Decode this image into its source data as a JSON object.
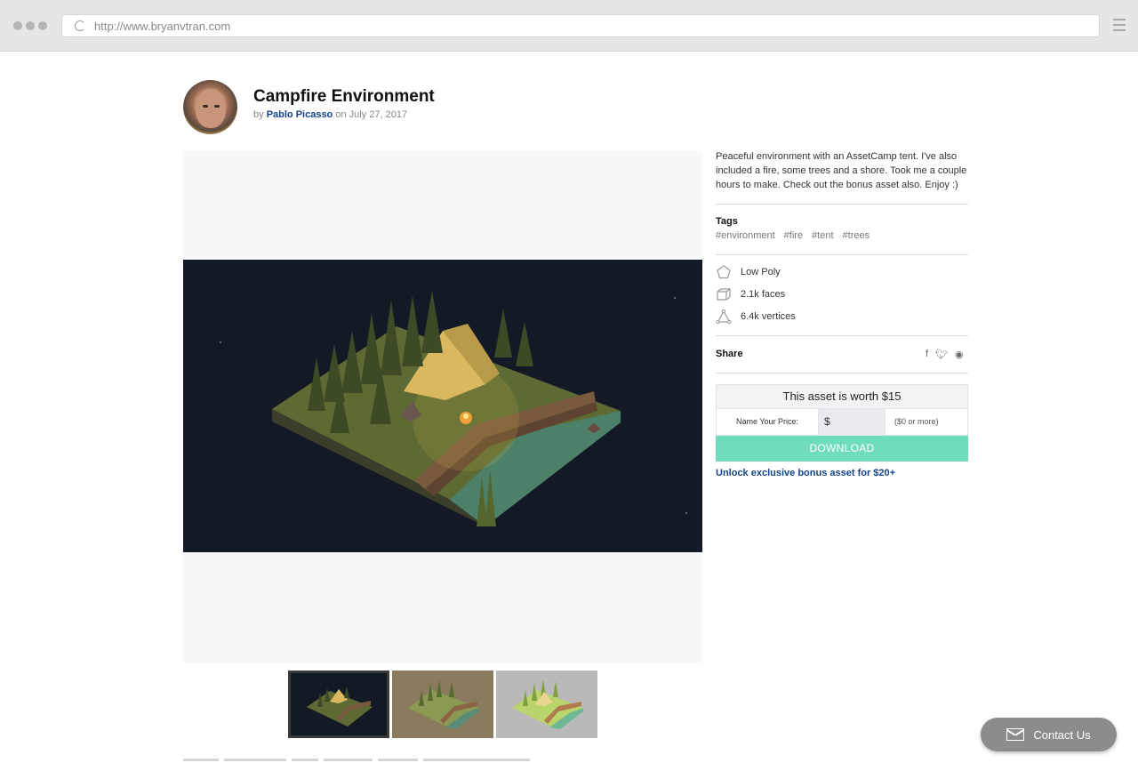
{
  "browser": {
    "url": "http://www.bryanvtran.com"
  },
  "post": {
    "title": "Campfire Environment",
    "by_prefix": "by",
    "author": "Pablo Picasso",
    "date_text": "on July 27, 2017"
  },
  "details": {
    "description": "Peaceful environment with an AssetCamp tent. I've also included a fire, some trees and a shore. Took me a couple hours to make. Check out the bonus asset also. Enjoy :)",
    "tags_label": "Tags",
    "tags": [
      "#environment",
      "#fire",
      "#tent",
      "#trees"
    ],
    "specs": {
      "style": "Low Poly",
      "faces": "2.1k faces",
      "vertices": "6.4k vertices"
    },
    "share_label": "Share",
    "share_icons": [
      "facebook-icon",
      "twitter-icon",
      "reddit-icon"
    ]
  },
  "purchase": {
    "worth": "This asset is worth $15",
    "name_price_label": "Name Your Price:",
    "currency": "$",
    "min_note": "($0 or more)",
    "download_label": "DOWNLOAD",
    "bonus_link": "Unlock exclusive bonus asset for $20+"
  },
  "thumbnails": [
    "night",
    "sepia",
    "day"
  ],
  "contact": {
    "label": "Contact Us"
  },
  "colors": {
    "accent": "#6fdcbe",
    "link": "#12448a",
    "scene_bg": "#131a26"
  }
}
